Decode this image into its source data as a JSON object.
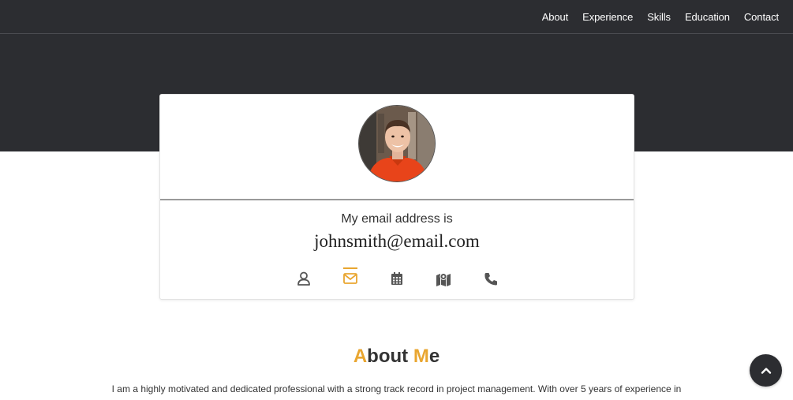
{
  "nav": {
    "items": [
      {
        "label": "About"
      },
      {
        "label": "Experience"
      },
      {
        "label": "Skills"
      },
      {
        "label": "Education"
      },
      {
        "label": "Contact"
      }
    ]
  },
  "profile": {
    "label": "My email address is",
    "value": "johnsmith@email.com",
    "active_icon": "email-icon",
    "icons": [
      "user-icon",
      "email-icon",
      "calendar-icon",
      "map-icon",
      "phone-icon"
    ]
  },
  "about": {
    "title_first_letter": "A",
    "title_part1": "bout ",
    "title_second_letter": "M",
    "title_part2": "e",
    "text": "I am a highly motivated and dedicated professional with a strong track record in project management. With over 5 years of experience in"
  },
  "colors": {
    "dark": "#2c2d31",
    "accent": "#e9a630",
    "icon": "#555555"
  },
  "scroll_top": {
    "icon": "chevron-up-icon"
  }
}
